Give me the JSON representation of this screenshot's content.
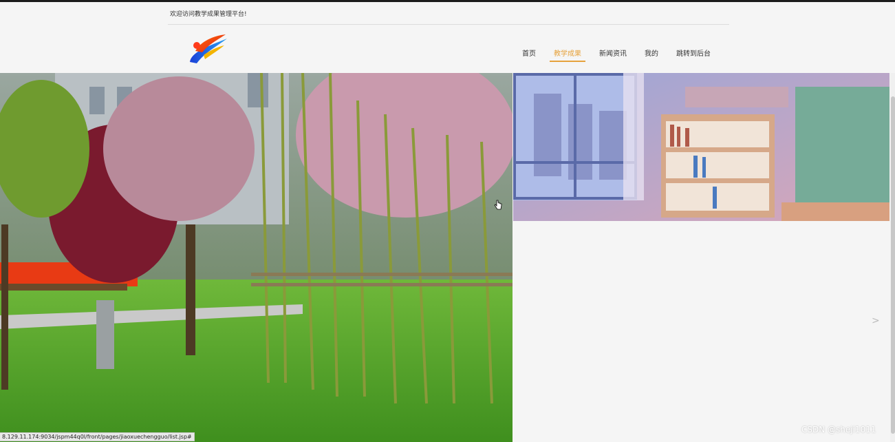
{
  "header": {
    "welcome_text": "欢迎访问教学成果管理平台!"
  },
  "nav": {
    "items": [
      {
        "label": "首页"
      },
      {
        "label": "教学成果"
      },
      {
        "label": "新闻资讯"
      },
      {
        "label": "我的"
      },
      {
        "label": "跳转到后台"
      }
    ],
    "active_index": 1,
    "accent_color": "#e6a23c"
  },
  "carousel": {
    "next_arrow": ">"
  },
  "statusbar": {
    "url": "8.129.11.174:9034/jspm44q0l/front/pages/jiaoxuechengguo/list.jsp#"
  },
  "watermark": "CSDN @sheji1011"
}
